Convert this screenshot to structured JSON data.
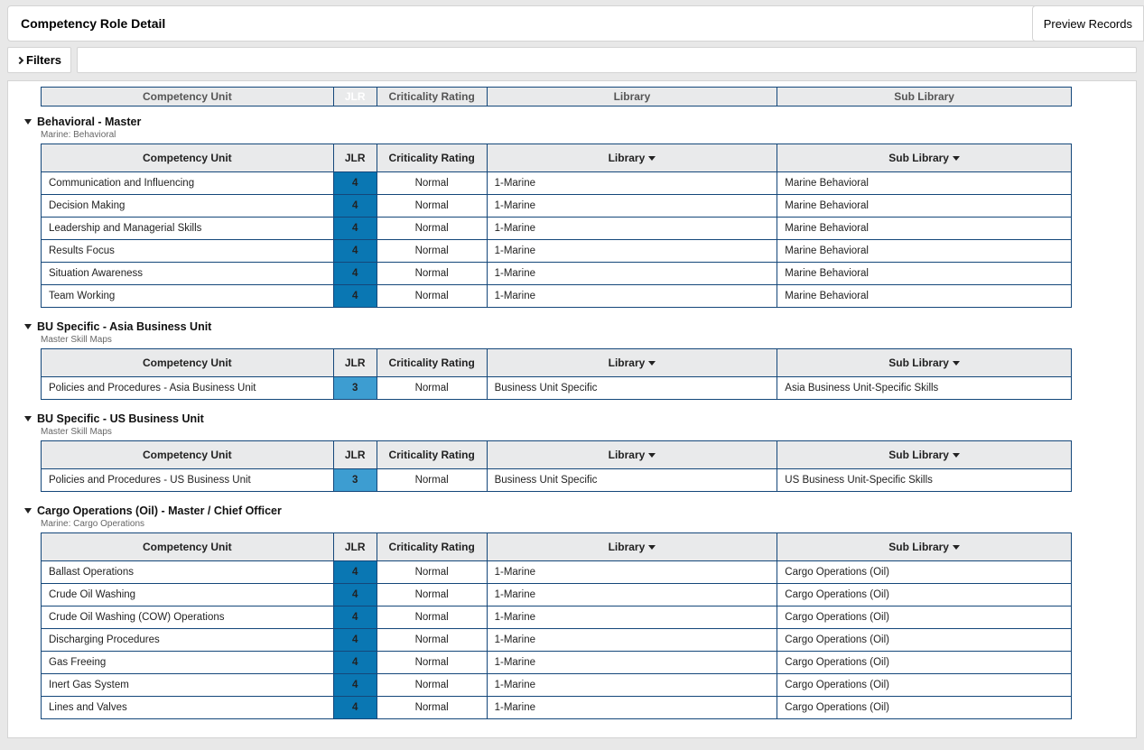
{
  "header": {
    "title": "Competency Role Detail",
    "preview_button": "Preview Records"
  },
  "filters": {
    "button_label": "Filters",
    "input_value": ""
  },
  "columns": {
    "unit": "Competency Unit",
    "jlr": "JLR",
    "criticality": "Criticality Rating",
    "library": "Library",
    "sub_library": "Sub Library"
  },
  "partial_header": {
    "unit": "Competency Unit",
    "jlr": "JLR",
    "criticality": "Criticality Rating",
    "library": "Library",
    "sub_library": "Sub Library"
  },
  "groups": [
    {
      "title": "Behavioral - Master",
      "subtitle": "Marine: Behavioral",
      "rows": [
        {
          "unit": "Communication and Influencing",
          "jlr": "4",
          "crit": "Normal",
          "lib": "1-Marine",
          "sublib": "Marine Behavioral"
        },
        {
          "unit": "Decision Making",
          "jlr": "4",
          "crit": "Normal",
          "lib": "1-Marine",
          "sublib": "Marine Behavioral"
        },
        {
          "unit": "Leadership and Managerial Skills",
          "jlr": "4",
          "crit": "Normal",
          "lib": "1-Marine",
          "sublib": "Marine Behavioral"
        },
        {
          "unit": "Results Focus",
          "jlr": "4",
          "crit": "Normal",
          "lib": "1-Marine",
          "sublib": "Marine Behavioral"
        },
        {
          "unit": "Situation Awareness",
          "jlr": "4",
          "crit": "Normal",
          "lib": "1-Marine",
          "sublib": "Marine Behavioral"
        },
        {
          "unit": "Team Working",
          "jlr": "4",
          "crit": "Normal",
          "lib": "1-Marine",
          "sublib": "Marine Behavioral"
        }
      ]
    },
    {
      "title": "BU Specific - Asia Business Unit",
      "subtitle": "Master Skill Maps",
      "rows": [
        {
          "unit": "Policies and Procedures - Asia Business Unit",
          "jlr": "3",
          "crit": "Normal",
          "lib": "Business Unit Specific",
          "sublib": "Asia Business Unit-Specific Skills"
        }
      ]
    },
    {
      "title": "BU Specific - US Business Unit",
      "subtitle": "Master Skill Maps",
      "rows": [
        {
          "unit": "Policies and Procedures - US Business Unit",
          "jlr": "3",
          "crit": "Normal",
          "lib": "Business Unit Specific",
          "sublib": "US Business Unit-Specific Skills"
        }
      ]
    },
    {
      "title": "Cargo Operations (Oil) - Master / Chief Officer",
      "subtitle": "Marine: Cargo Operations",
      "rows": [
        {
          "unit": "Ballast Operations",
          "jlr": "4",
          "crit": "Normal",
          "lib": "1-Marine",
          "sublib": "Cargo Operations (Oil)"
        },
        {
          "unit": "Crude Oil Washing",
          "jlr": "4",
          "crit": "Normal",
          "lib": "1-Marine",
          "sublib": "Cargo Operations (Oil)"
        },
        {
          "unit": "Crude Oil Washing (COW) Operations",
          "jlr": "4",
          "crit": "Normal",
          "lib": "1-Marine",
          "sublib": "Cargo Operations (Oil)"
        },
        {
          "unit": "Discharging  Procedures",
          "jlr": "4",
          "crit": "Normal",
          "lib": "1-Marine",
          "sublib": "Cargo Operations (Oil)"
        },
        {
          "unit": "Gas Freeing",
          "jlr": "4",
          "crit": "Normal",
          "lib": "1-Marine",
          "sublib": "Cargo Operations (Oil)"
        },
        {
          "unit": "Inert Gas System",
          "jlr": "4",
          "crit": "Normal",
          "lib": "1-Marine",
          "sublib": "Cargo Operations (Oil)"
        },
        {
          "unit": "Lines and Valves",
          "jlr": "4",
          "crit": "Normal",
          "lib": "1-Marine",
          "sublib": "Cargo Operations (Oil)"
        }
      ]
    }
  ]
}
